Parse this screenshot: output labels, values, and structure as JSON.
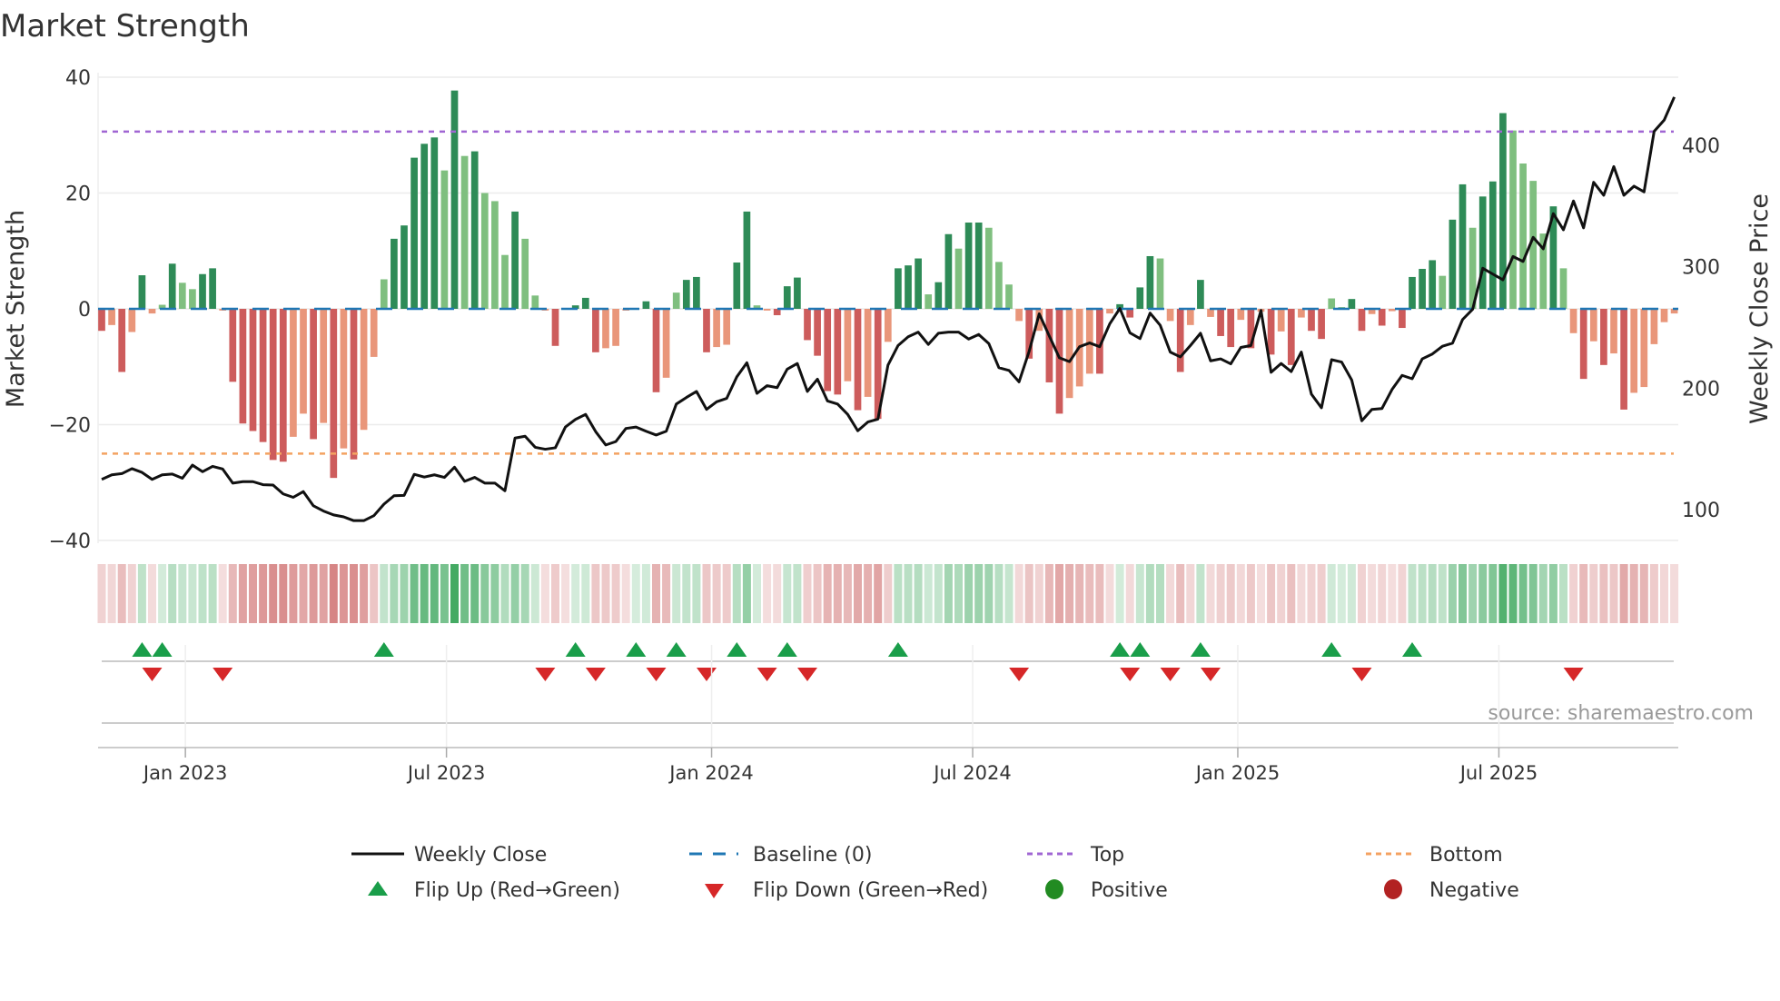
{
  "title": "Market Strength",
  "source": "source: sharemaestro.com",
  "colors": {
    "strong_green": "#2e8b57",
    "weak_green": "#7fbf7f",
    "strong_red": "#cd5c5c",
    "weak_red": "#e9967a",
    "price": "#111111",
    "baseline": "#1f77b4",
    "top": "#a066d3",
    "bottom": "#f4a261",
    "flip_up": "#1a9e4a",
    "flip_down": "#d62728",
    "positive": "#228b22",
    "negative": "#b22222"
  },
  "legend": {
    "weekly_close": "Weekly Close",
    "baseline": "Baseline (0)",
    "top": "Top",
    "bottom": "Bottom",
    "flip_up": "Flip Up (Red→Green)",
    "flip_down": "Flip Down (Green→Red)",
    "positive": "Positive",
    "negative": "Negative"
  },
  "chart_data": {
    "type": "bar",
    "title": "Market Strength",
    "xlabel": "",
    "ylabel": "Market Strength",
    "y2label": "Weekly Close Price",
    "ylim": [
      -40,
      40
    ],
    "y2lim": [
      100,
      400
    ],
    "yticks": [
      {
        "v": 40,
        "label": "40"
      },
      {
        "v": 20,
        "label": "20"
      },
      {
        "v": 0,
        "label": "0"
      },
      {
        "v": -20,
        "label": "−20"
      },
      {
        "v": -40,
        "label": "−40"
      }
    ],
    "y2ticks": [
      {
        "v": 400,
        "label": "400"
      },
      {
        "v": 300,
        "label": "300"
      },
      {
        "v": 200,
        "label": "200"
      },
      {
        "v": 100,
        "label": "100"
      }
    ],
    "xticks": [
      {
        "week": 8.3,
        "label": "Jan 2023"
      },
      {
        "week": 34.2,
        "label": "Jul 2023"
      },
      {
        "week": 60.5,
        "label": "Jan 2024"
      },
      {
        "week": 86.4,
        "label": "Jul 2024"
      },
      {
        "week": 112.7,
        "label": "Jan 2025"
      },
      {
        "week": 138.6,
        "label": "Jul 2025"
      }
    ],
    "grid": true,
    "legend_position": "bottom",
    "top_level": 30.6,
    "bottom_level": -25,
    "baseline": 0,
    "series": [
      {
        "name": "Market Strength",
        "type": "bar",
        "values": [
          -3.8,
          -2.8,
          -10.9,
          -4.0,
          5.8,
          -0.8,
          0.7,
          7.8,
          4.5,
          3.4,
          6.0,
          7.0,
          -0.3,
          -12.6,
          -19.8,
          -21.1,
          -23.0,
          -26.1,
          -26.4,
          -22.1,
          -18.1,
          -22.5,
          -19.7,
          -29.2,
          -24.1,
          -26.0,
          -20.9,
          -8.3,
          5.1,
          12.1,
          14.4,
          26.1,
          28.5,
          29.6,
          23.9,
          37.7,
          26.4,
          27.2,
          20.0,
          18.6,
          9.3,
          16.8,
          12.1,
          2.3,
          -0.3,
          -6.4,
          -0.1,
          0.6,
          1.9,
          -7.5,
          -6.8,
          -6.4,
          -0.3,
          0.1,
          1.3,
          -14.4,
          -11.9,
          2.8,
          5.0,
          5.5,
          -7.5,
          -6.6,
          -6.2,
          8.0,
          16.8,
          0.6,
          -0.3,
          -1.1,
          3.9,
          5.4,
          -5.4,
          -8.1,
          -14.2,
          -14.8,
          -12.5,
          -17.5,
          -15.2,
          -19.0,
          -5.7,
          7.0,
          7.5,
          8.7,
          2.5,
          4.6,
          12.9,
          10.4,
          14.9,
          14.9,
          14.0,
          8.1,
          4.2,
          -2.1,
          -8.6,
          -3.8,
          -12.7,
          -18.1,
          -15.4,
          -13.4,
          -11.2,
          -11.2,
          -0.8,
          0.8,
          -1.5,
          3.7,
          9.1,
          8.7,
          -2.1,
          -10.9,
          -2.8,
          5.0,
          -1.4,
          -4.7,
          -6.6,
          -1.9,
          -6.8,
          -0.5,
          -7.9,
          -3.9,
          -9.7,
          -1.5,
          -3.8,
          -5.2,
          1.8,
          0.3,
          1.7,
          -3.8,
          -0.9,
          -2.9,
          -0.4,
          -3.3,
          5.5,
          6.9,
          8.4,
          5.7,
          15.4,
          21.5,
          14.0,
          19.4,
          22.0,
          33.8,
          30.8,
          25.1,
          22.1,
          13.0,
          17.7,
          7.0,
          -4.2,
          -12.1,
          -5.6,
          -9.7,
          -7.7,
          -17.4,
          -14.5,
          -13.5,
          -6.1,
          -2.3,
          -0.8
        ]
      },
      {
        "name": "Weekly Close",
        "type": "line",
        "axis": "right",
        "values": [
          124.9,
          128.6,
          129.6,
          133.7,
          130.6,
          124.9,
          128.6,
          129.3,
          125.8,
          136.6,
          131.2,
          135.6,
          133.4,
          121.8,
          123.0,
          123.0,
          120.5,
          120.2,
          112.9,
          110.1,
          114.8,
          103.1,
          98.8,
          95.6,
          94.0,
          90.9,
          90.9,
          95.0,
          104.5,
          111.4,
          111.7,
          129.0,
          126.8,
          128.6,
          126.5,
          134.9,
          123.3,
          126.5,
          121.8,
          121.8,
          115.5,
          158.9,
          160.4,
          151.3,
          149.7,
          150.9,
          168.0,
          174.3,
          178.4,
          164.2,
          153.2,
          156.0,
          166.8,
          168.0,
          164.5,
          161.4,
          164.5,
          186.9,
          192.3,
          197.3,
          182.5,
          188.8,
          191.6,
          209.3,
          220.9,
          195.7,
          202.0,
          200.4,
          215.6,
          220.3,
          197.3,
          207.4,
          189.4,
          186.9,
          178.4,
          164.9,
          172.1,
          174.5,
          219.0,
          235.1,
          242.3,
          246.1,
          236.0,
          245.2,
          246.1,
          246.1,
          240.4,
          244.2,
          236.7,
          216.8,
          214.6,
          205.2,
          230.3,
          261.2,
          242.9,
          225.0,
          221.8,
          234.1,
          237.2,
          234.1,
          253.0,
          265.6,
          245.5,
          240.8,
          261.8,
          251.8,
          229.7,
          225.7,
          235.1,
          245.2,
          222.5,
          224.1,
          220.0,
          233.5,
          235.1,
          264.0,
          213.0,
          220.3,
          213.6,
          229.7,
          195.1,
          183.8,
          223.4,
          221.5,
          206.7,
          173.1,
          182.5,
          183.2,
          198.9,
          210.5,
          207.7,
          224.1,
          228.1,
          234.5,
          237.0,
          256.5,
          265.0,
          298.7,
          293.9,
          289.2,
          308.4,
          304.3,
          324.2,
          314.7,
          343.7,
          330.4,
          354.1,
          332.0,
          369.5,
          358.8,
          382.4,
          358.8,
          366.3,
          361.6,
          411.4,
          420.8,
          439.7
        ]
      }
    ]
  }
}
